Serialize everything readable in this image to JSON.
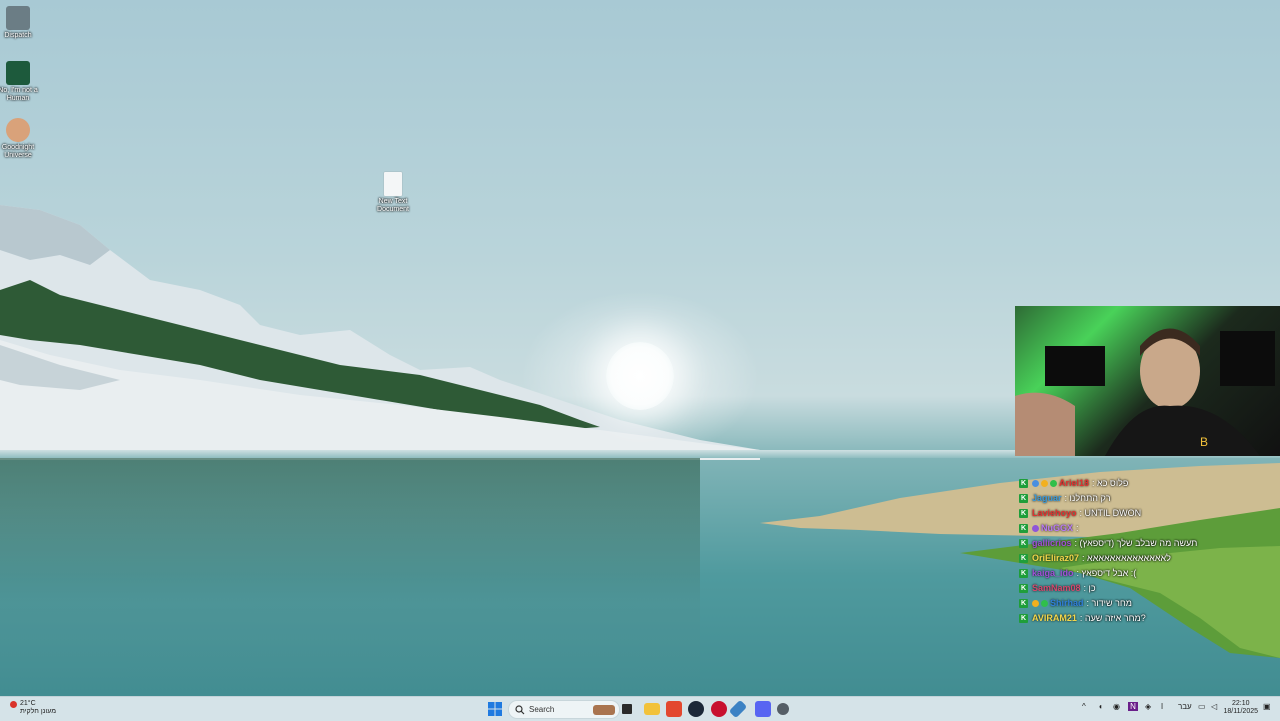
{
  "desktop": {
    "icons": [
      {
        "label": "Dispatch",
        "color": "#6b7d85"
      },
      {
        "label": "No, I'm not a Human",
        "color": "#1d5a3c"
      },
      {
        "label": "Goodnight Universe",
        "color": "#d9a27a"
      },
      {
        "label": "New Text Document",
        "color": "#f4f6f7"
      }
    ]
  },
  "chat": {
    "messages": [
      {
        "user": "Ariel18",
        "text": ": פלוס כא",
        "user_color": "#e0312f",
        "badges": [
          "#4a8fe0",
          "#f2b01e",
          "#2fbf4a"
        ]
      },
      {
        "user": "Jaguar",
        "text": ": רק התחלנו",
        "user_color": "#3a9ad9",
        "badges": []
      },
      {
        "user": "Laviehoyo",
        "text": ": UNTIL DWON",
        "user_color": "#e0312f",
        "badges": []
      },
      {
        "user": "NuGGX",
        "text": ":",
        "user_color": "#b978f5",
        "badges": [
          "#8f55d8"
        ]
      },
      {
        "user": "gallicrios",
        "text": ": תעשה מה שבלב שלך (דיספאץ)",
        "user_color": "#a04fd6",
        "badges": []
      },
      {
        "user": "OriEliraz07",
        "text": ": לאאאאאאאאאאאאאא",
        "user_color": "#f2d64b",
        "badges": []
      },
      {
        "user": "kaiga_ido",
        "text": ": אבל דיספאץ :(",
        "user_color": "#a04fd6",
        "badges": []
      },
      {
        "user": "SamNam08",
        "text": ": כן",
        "user_color": "#d6476d",
        "badges": []
      },
      {
        "user": "Shirhad",
        "text": ": מחר שידור",
        "user_color": "#2f7fd9",
        "badges": [
          "#f2b01e",
          "#2fbf4a"
        ]
      },
      {
        "user": "AVIRAM21",
        "text": ": מחר איזה שעה?",
        "user_color": "#f2d64b",
        "badges": []
      }
    ]
  },
  "taskbar": {
    "weather": {
      "temp": "21°C",
      "desc": "מעונן חלקית"
    },
    "search_placeholder": "Search",
    "clock": {
      "time": "22:10",
      "date": "18/11/2025"
    },
    "language": "עבר",
    "apps": [
      {
        "name": "start",
        "color": "#1f7ae0"
      },
      {
        "name": "task-view",
        "color": "#2a2a2a"
      },
      {
        "name": "file-explorer",
        "color": "#f2c23a"
      },
      {
        "name": "brave",
        "color": "#e3482f"
      },
      {
        "name": "steam",
        "color": "#1b2838"
      },
      {
        "name": "git-client",
        "color": "#c8102e"
      },
      {
        "name": "edge-app",
        "color": "#3b82c4"
      },
      {
        "name": "discord",
        "color": "#5865f2"
      },
      {
        "name": "settings",
        "color": "#555e66"
      }
    ]
  }
}
